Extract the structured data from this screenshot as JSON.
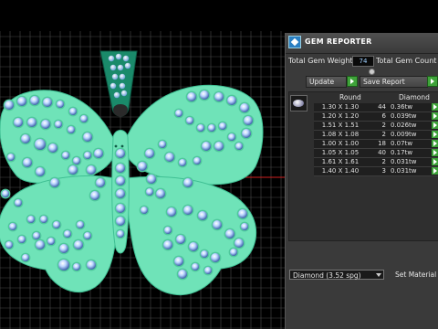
{
  "panel": {
    "title": "GEM REPORTER",
    "total_gem_weight_label": "Total Gem Weight",
    "total_gem_weight_value": "74",
    "total_gem_count_label": "Total Gem Count",
    "update_label": "Update",
    "save_report_label": "Save Report",
    "table": {
      "col_round": "Round",
      "col_diamond": "Diamond",
      "rows": [
        {
          "size": "1.30 X 1.30",
          "count": "44",
          "weight": "0.36tw"
        },
        {
          "size": "1.20 X 1.20",
          "count": "6",
          "weight": "0.039tw"
        },
        {
          "size": "1.51 X 1.51",
          "count": "2",
          "weight": "0.026tw"
        },
        {
          "size": "1.08 X 1.08",
          "count": "2",
          "weight": "0.009tw"
        },
        {
          "size": "1.00 X 1.00",
          "count": "18",
          "weight": "0.07tw"
        },
        {
          "size": "1.05 X 1.05",
          "count": "40",
          "weight": "0.17tw"
        },
        {
          "size": "1.61 X 1.61",
          "count": "2",
          "weight": "0.031tw"
        },
        {
          "size": "1.40 X 1.40",
          "count": "3",
          "weight": "0.031tw"
        }
      ]
    },
    "material_select": "Diamond    (3.52 spg)",
    "set_material_label": "Set Material"
  },
  "colors": {
    "pendant": "#6fe3b8",
    "bail": "#1a8a6a",
    "grid": "#4a4a4a",
    "axis_red": "#d02020",
    "gem": "#a8c8ff",
    "button_green": "#3fa33a",
    "panel_bg": "#3a3a3a"
  },
  "icons": [
    "gem-reporter-logo-icon",
    "update-arrow-icon",
    "save-report-arrow-icon",
    "row-arrow-icon",
    "dropdown-arrow-icon",
    "round-gem-icon"
  ]
}
